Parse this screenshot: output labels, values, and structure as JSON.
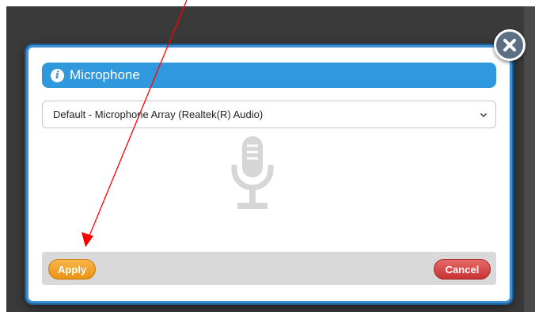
{
  "dialog": {
    "title": "Microphone",
    "select": {
      "value": "Default - Microphone Array (Realtek(R) Audio)"
    },
    "footer": {
      "apply_label": "Apply",
      "cancel_label": "Cancel"
    }
  },
  "icons": {
    "close": "close-icon",
    "info": "info-icon",
    "chevron": "chevron-down-icon",
    "microphone": "microphone-icon"
  },
  "colors": {
    "title_bar": "#3098dc",
    "modal_border": "#3d8fd4",
    "apply_button": "#f0a22a",
    "cancel_button": "#d64545",
    "close_button": "#5d6f84",
    "annotation_arrow": "#ff0000"
  }
}
